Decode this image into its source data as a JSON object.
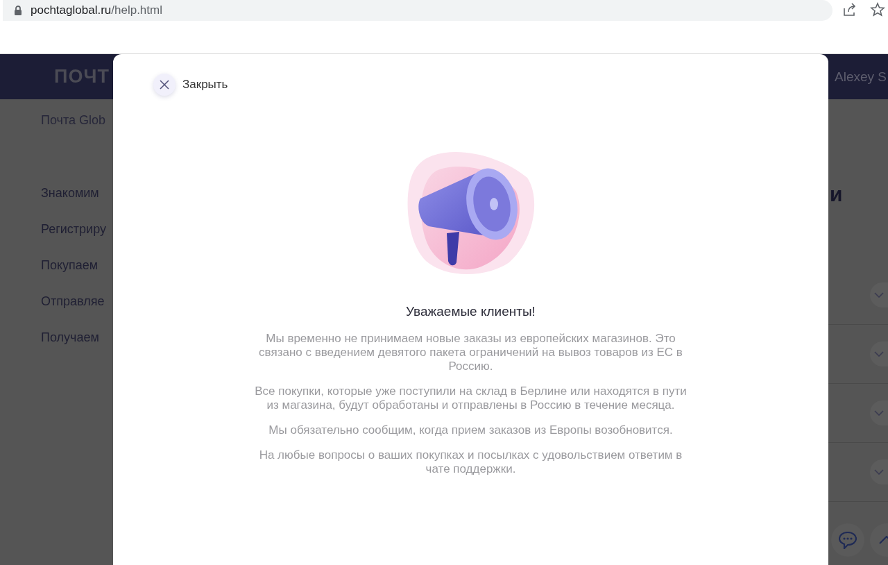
{
  "browser": {
    "url_host": "pochtaglobal.ru",
    "url_path": "/help.html"
  },
  "site": {
    "header": {
      "logo": "ПОЧТ",
      "user": "Alexey S"
    },
    "breadcrumb": "Почта Glob",
    "sidebar": {
      "items": [
        "Знакомим",
        "Регистриру",
        "Покупаем",
        "Отправляе",
        "Получаем"
      ]
    },
    "heading": "и",
    "accordion": [
      {
        "expanded": false
      },
      {
        "expanded": false
      },
      {
        "expanded": false
      },
      {
        "expanded": false
      }
    ]
  },
  "modal": {
    "close_label": "Закрыть",
    "title": "Уважаемые клиенты!",
    "paragraphs": [
      "Мы временно не принимаем новые заказы из европейских магазинов. Это связано с введением девятого пакета ограничений на вывоз товаров из ЕС в Россию.",
      "Все покупки, которые уже поступили на склад в Берлине или находятся в пути из магазина, будут обработаны и отправлены в Россию в течение месяца.",
      "Мы обязательно сообщим, когда прием заказов из Европы возобновится.",
      "На любые вопросы о ваших покупках и посылках с удовольствием ответим в чате поддержки."
    ]
  }
}
